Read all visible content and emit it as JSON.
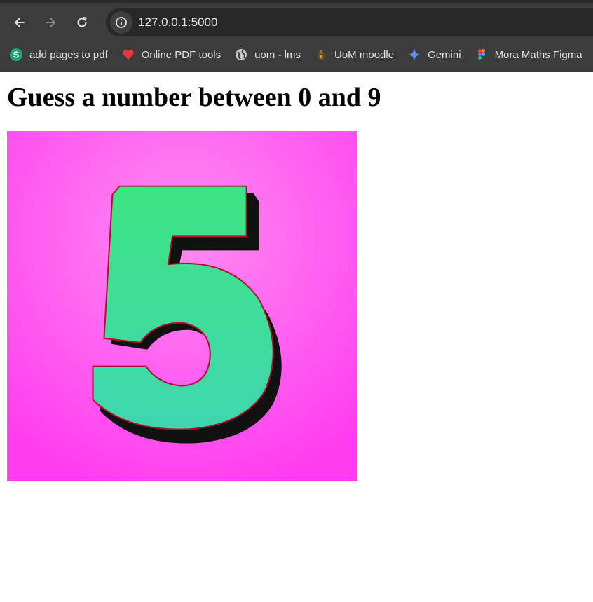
{
  "browser": {
    "url": "127.0.0.1:5000",
    "bookmarks": [
      {
        "label": "add pages to pdf",
        "icon": "s-letter-icon"
      },
      {
        "label": "Online PDF tools",
        "icon": "heart-pdf-icon"
      },
      {
        "label": "uom - lms",
        "icon": "globe-icon"
      },
      {
        "label": "UoM moodle",
        "icon": "moodle-icon"
      },
      {
        "label": "Gemini",
        "icon": "gemini-sparkle-icon"
      },
      {
        "label": "Mora Maths Figma",
        "icon": "figma-icon"
      }
    ]
  },
  "page": {
    "heading": "Guess a number between 0 and 9",
    "image": {
      "digit": "5",
      "icon": "number-five-image"
    }
  },
  "colors": {
    "chrome_bg": "#3c3c3c",
    "omnibox_bg": "#282828",
    "image_bg": "#ff5cf0",
    "digit_fill": "#3fe08a"
  }
}
